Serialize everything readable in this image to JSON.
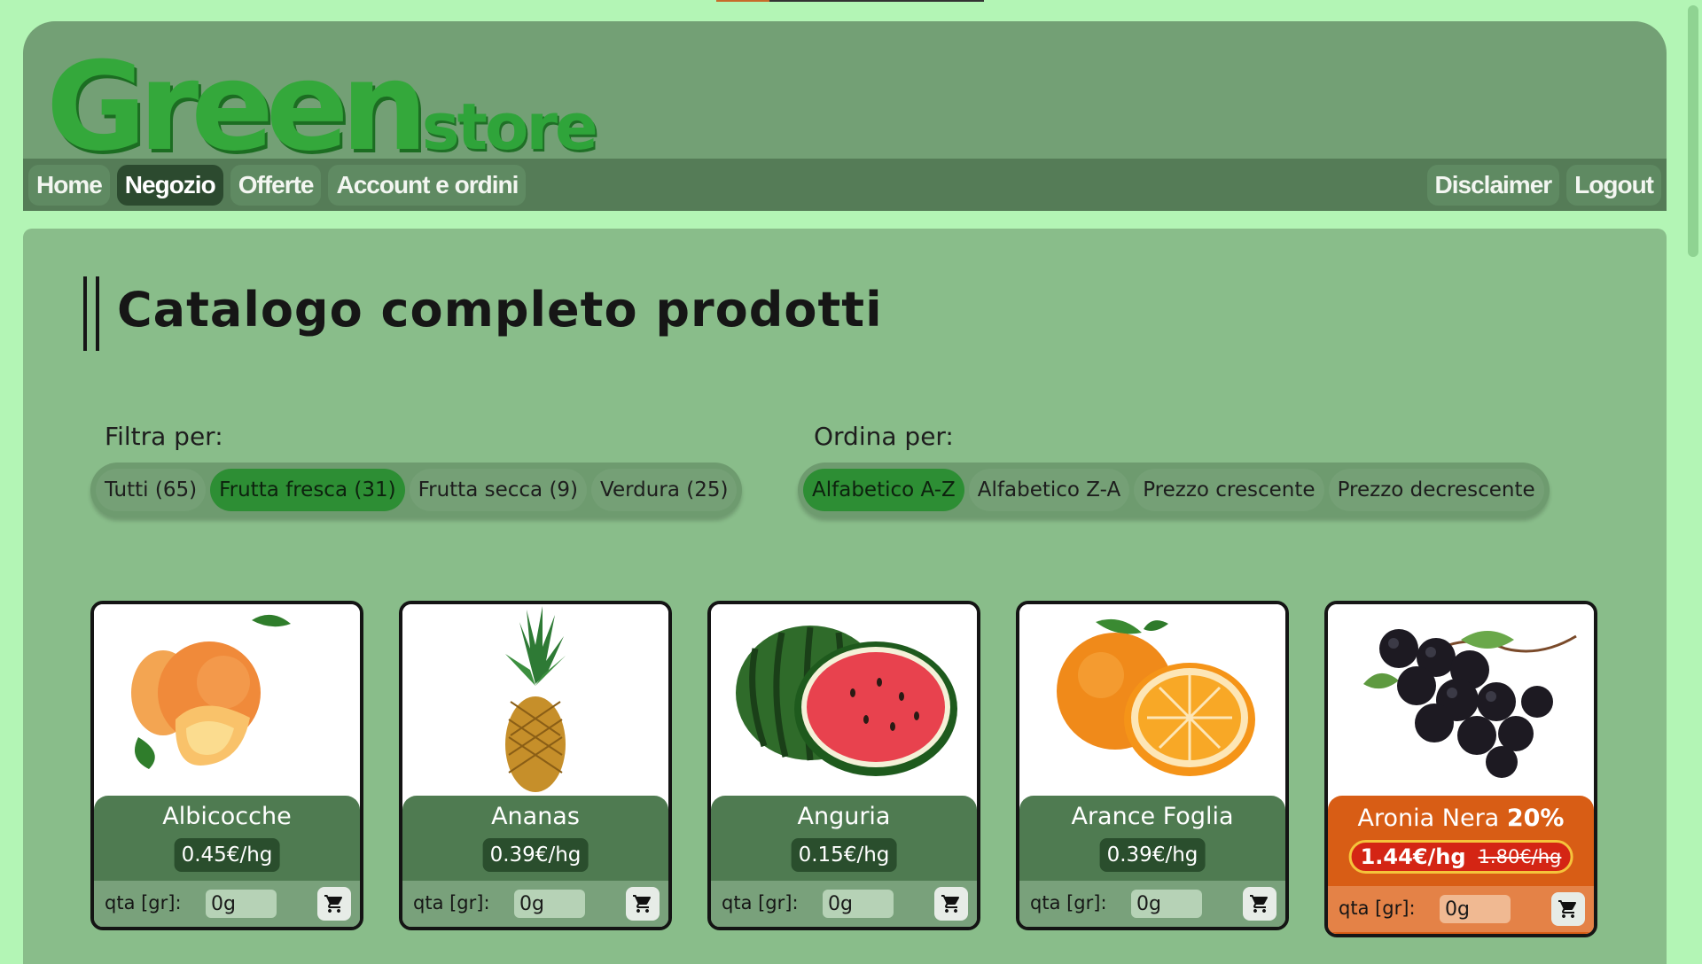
{
  "logo": {
    "green": "Green",
    "store": "store"
  },
  "nav": {
    "home": "Home",
    "shop": "Negozio",
    "offers": "Offerte",
    "account": "Account e ordini",
    "disclaimer": "Disclaimer",
    "logout": "Logout"
  },
  "page": {
    "title": "Catalogo completo prodotti"
  },
  "filters": {
    "label": "Filtra per:",
    "options": [
      "Tutti (65)",
      "Frutta fresca (31)",
      "Frutta secca (9)",
      "Verdura (25)"
    ],
    "selected": "Frutta fresca (31)"
  },
  "sort": {
    "label": "Ordina per:",
    "options": [
      "Alfabetico A-Z",
      "Alfabetico Z-A",
      "Prezzo crescente",
      "Prezzo decrescente"
    ],
    "selected": "Alfabetico A-Z"
  },
  "qty_label": "qta [gr]:",
  "products": [
    {
      "name": "Albicocche",
      "price": "0.45€/hg",
      "qty": "0g",
      "image": "apricot"
    },
    {
      "name": "Ananas",
      "price": "0.39€/hg",
      "qty": "0g",
      "image": "pineapple"
    },
    {
      "name": "Anguria",
      "price": "0.15€/hg",
      "qty": "0g",
      "image": "watermelon"
    },
    {
      "name": "Arance Foglia",
      "price": "0.39€/hg",
      "qty": "0g",
      "image": "orange"
    },
    {
      "name": "Aronia Nera",
      "discount": "20%",
      "price": "1.44€/hg",
      "old_price": "1.80€/hg",
      "qty": "0g",
      "image": "aronia-berries"
    }
  ],
  "colors": {
    "page_bg": "#b3f5b5",
    "header_bg": "#73a075",
    "nav_bg": "#557c57",
    "content_bg": "#89bd8a",
    "accent_green": "#2d8e34",
    "offer_orange": "#d85d15",
    "offer_price_red": "#d42514"
  },
  "icons": [
    "cart-icon"
  ]
}
